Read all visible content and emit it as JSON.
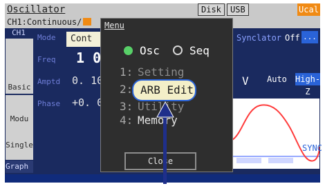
{
  "window": {
    "title": "Oscillator",
    "tabs": {
      "disk": "Disk",
      "usb": "USB",
      "ucal": "Ucal"
    },
    "channel_mode": "CH1:Continuous/"
  },
  "left_sidebar": {
    "channel": "CH1",
    "items": [
      {
        "label": "Basic"
      },
      {
        "label": "Modu"
      },
      {
        "label": "Single"
      },
      {
        "label": "Graph"
      }
    ]
  },
  "parameters": {
    "mode": {
      "label": "Mode",
      "value": "Cont"
    },
    "freq": {
      "label": "Freq",
      "value": "1 0"
    },
    "amptd": {
      "label": "Amptd",
      "value": "0. 10"
    },
    "phase": {
      "label": "Phase",
      "value": "+0. 0"
    }
  },
  "right_panel": {
    "syncator": {
      "label": "Synclator",
      "value": "Off",
      "button": "..."
    },
    "v": {
      "label": "V"
    },
    "auto": "Auto",
    "high_z": "High-Z",
    "waveform_sync_label": "SYNC"
  },
  "menu": {
    "title": "Menu",
    "options": {
      "osc": {
        "label": "Osc",
        "selected": true
      },
      "seq": {
        "label": "Seq",
        "selected": false
      }
    },
    "items": [
      {
        "index": "1:",
        "label": "Setting"
      },
      {
        "index": "2:",
        "label": "ARB Edit"
      },
      {
        "index": "3:",
        "label": "Utility"
      },
      {
        "index": "4:",
        "label": "Memory"
      }
    ],
    "close": "Close"
  },
  "colors": {
    "accent": "#2a63d8",
    "orange": "#f08a14",
    "panel": "#1a2a5f",
    "menu_bg": "#2e2e2e"
  }
}
